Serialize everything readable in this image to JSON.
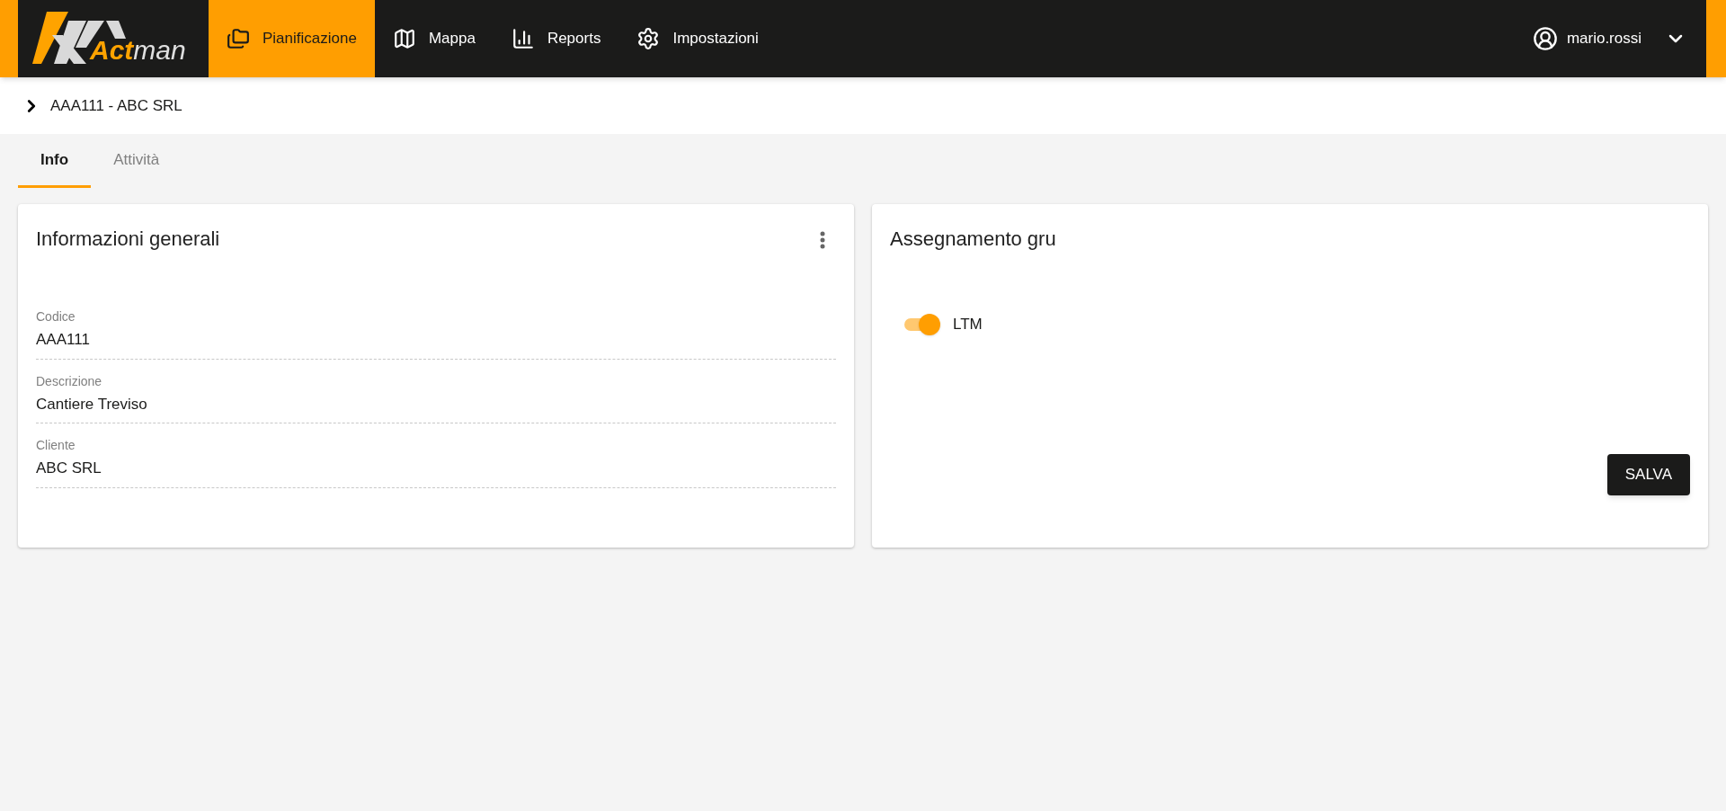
{
  "logo": {
    "strong": "Act",
    "light": "man"
  },
  "nav": [
    {
      "label": "Pianificazione",
      "selected": true
    },
    {
      "label": "Mappa",
      "selected": false
    },
    {
      "label": "Reports",
      "selected": false
    },
    {
      "label": "Impostazioni",
      "selected": false
    }
  ],
  "user": {
    "name": "mario.rossi"
  },
  "breadcrumb": "AAA111 - ABC SRL",
  "tabs": [
    {
      "label": "Info",
      "selected": true
    },
    {
      "label": "Attività",
      "selected": false
    }
  ],
  "info_card": {
    "title": "Informazioni generali",
    "fields": [
      {
        "label": "Codice",
        "value": "AAA111"
      },
      {
        "label": "Descrizione",
        "value": "Cantiere Treviso"
      },
      {
        "label": "Cliente",
        "value": "ABC SRL"
      }
    ]
  },
  "crane_card": {
    "title": "Assegnamento gru",
    "toggles": [
      {
        "label": "LTM",
        "on": true
      }
    ],
    "save_button": "SALVA"
  }
}
